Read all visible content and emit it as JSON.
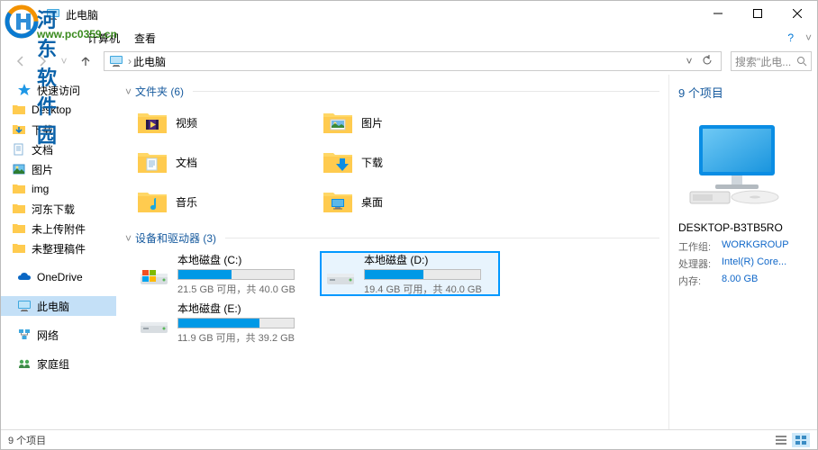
{
  "watermark": {
    "text": "河东软件园",
    "url": "www.pc0359.cn"
  },
  "titlebar": {
    "title": "此电脑"
  },
  "menubar": {
    "item1": "计算机",
    "item2": "查看"
  },
  "address": {
    "crumb": "此电脑"
  },
  "search": {
    "placeholder": "搜索\"此电..."
  },
  "sidebar": {
    "quick": "快速访问",
    "items": [
      "Desktop",
      "下载",
      "文档",
      "图片",
      "img",
      "河东下载",
      "未上传附件",
      "未整理稿件"
    ],
    "onedrive": "OneDrive",
    "thispc": "此电脑",
    "network": "网络",
    "homegroup": "家庭组"
  },
  "sections": {
    "folders_label": "文件夹 (6)",
    "drives_label": "设备和驱动器 (3)"
  },
  "folders": [
    "视频",
    "图片",
    "文档",
    "下载",
    "音乐",
    "桌面"
  ],
  "drives": [
    {
      "name": "本地磁盘 (C:)",
      "sub": "21.5 GB 可用，共 40.0 GB",
      "pct": 46
    },
    {
      "name": "本地磁盘 (D:)",
      "sub": "19.4 GB 可用，共 40.0 GB",
      "pct": 51,
      "selected": true
    },
    {
      "name": "本地磁盘 (E:)",
      "sub": "11.9 GB 可用，共 39.2 GB",
      "pct": 70
    }
  ],
  "details": {
    "count": "9 个项目",
    "name": "DESKTOP-B3TB5RO",
    "rows": [
      {
        "k": "工作组:",
        "v": "WORKGROUP"
      },
      {
        "k": "处理器:",
        "v": "Intel(R) Core..."
      },
      {
        "k": "内存:",
        "v": "8.00 GB"
      }
    ]
  },
  "statusbar": {
    "text": "9 个项目"
  }
}
